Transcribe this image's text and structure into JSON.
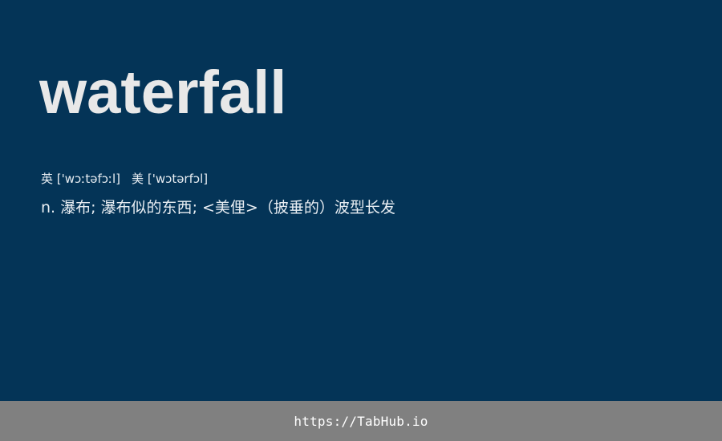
{
  "entry": {
    "word": "waterfall",
    "phonetics": {
      "uk_label": "英",
      "uk_ipa": "['wɔːtəfɔːl]",
      "us_label": "美",
      "us_ipa": "['wɔtərfɔl]"
    },
    "definition": "n. 瀑布; 瀑布似的东西; <美俚>（披垂的）波型长发"
  },
  "footer": {
    "link_text": "https://TabHub.io"
  },
  "colors": {
    "background": "#043457",
    "word_text": "#e8e8e8",
    "footer_background": "#808080",
    "footer_text": "#ffffff"
  }
}
